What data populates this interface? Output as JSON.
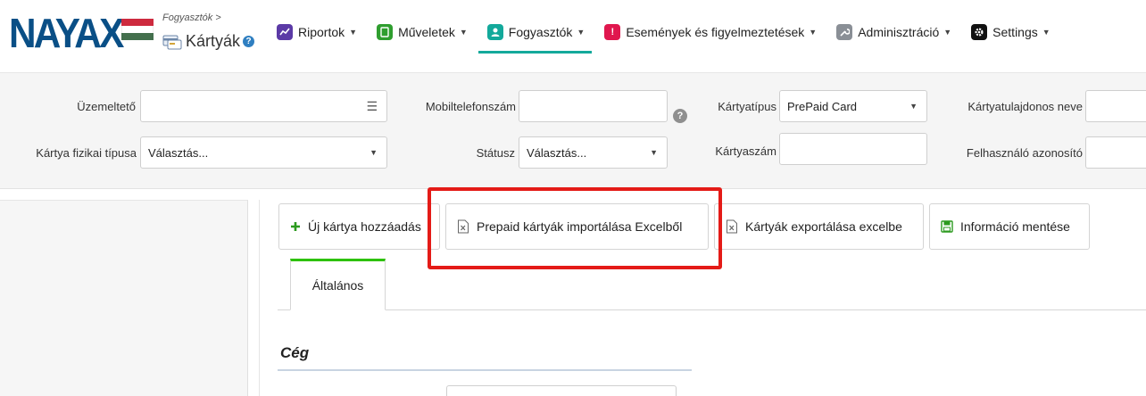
{
  "header": {
    "logo": "NAYAX",
    "breadcrumb": "Fogyasztók >",
    "page_title": "Kártyák",
    "help_glyph": "?",
    "nav": [
      {
        "label": "Riportok",
        "icon": "chart-icon",
        "color": "#5b3aa6"
      },
      {
        "label": "Műveletek",
        "icon": "operations-icon",
        "color": "#2f9e2f"
      },
      {
        "label": "Fogyasztók",
        "icon": "consumers-icon",
        "color": "#13a99b",
        "active": true
      },
      {
        "label": "Események és figyelmeztetések",
        "icon": "alert-icon",
        "color": "#e0174e"
      },
      {
        "label": "Adminisztráció",
        "icon": "admin-icon",
        "color": "#8a8f96"
      },
      {
        "label": "Settings",
        "icon": "gear-icon",
        "color": "#111111"
      }
    ],
    "accent": "#13a99b",
    "flag_colors": [
      "#cd2a3e",
      "#ffffff",
      "#436f4d"
    ]
  },
  "filters": {
    "operator_label": "Üzemeltető",
    "operator_value": "",
    "mobile_label": "Mobiltelefonszám",
    "mobile_value": "",
    "card_type_label": "Kártyatípus",
    "card_type_value": "PrePaid Card",
    "card_owner_label": "Kártyatulajdonos neve",
    "card_owner_value": "",
    "physical_type_label": "Kártya fizikai típusa",
    "physical_type_value": "Választás...",
    "status_label": "Státusz",
    "status_value": "Választás...",
    "card_number_label": "Kártyaszám",
    "card_number_value": "",
    "user_id_label": "Felhasználó azonosító",
    "user_id_value": ""
  },
  "toolbar": {
    "add_card": "Új kártya hozzáadás",
    "import_prepaid": "Prepaid kártyák importálása Excelből",
    "export_cards": "Kártyák exportálása excelbe",
    "save_info": "Információ mentése"
  },
  "tabs": [
    {
      "label": "Általános",
      "active": true
    }
  ],
  "section": {
    "title": "Cég"
  }
}
